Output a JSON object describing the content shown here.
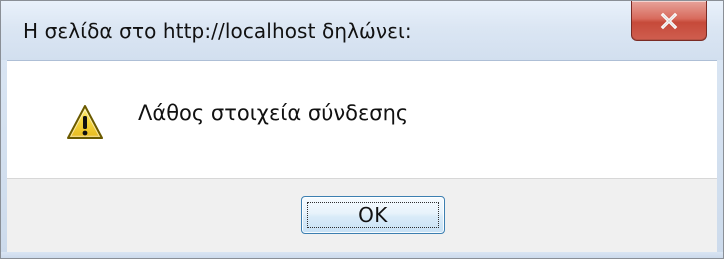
{
  "dialog": {
    "title": "Η σελίδα στο http://localhost δηλώνει:",
    "message": "Λάθος στοιχεία σύνδεσης",
    "buttons": {
      "ok_label": "OK"
    },
    "icons": {
      "close": "close-icon",
      "warning": "warning-icon"
    }
  },
  "colors": {
    "close_button": "#c64a3a",
    "warning_fill": "#f3d23a",
    "warning_outline": "#6b5a00",
    "button_border": "#3c7fb1"
  }
}
